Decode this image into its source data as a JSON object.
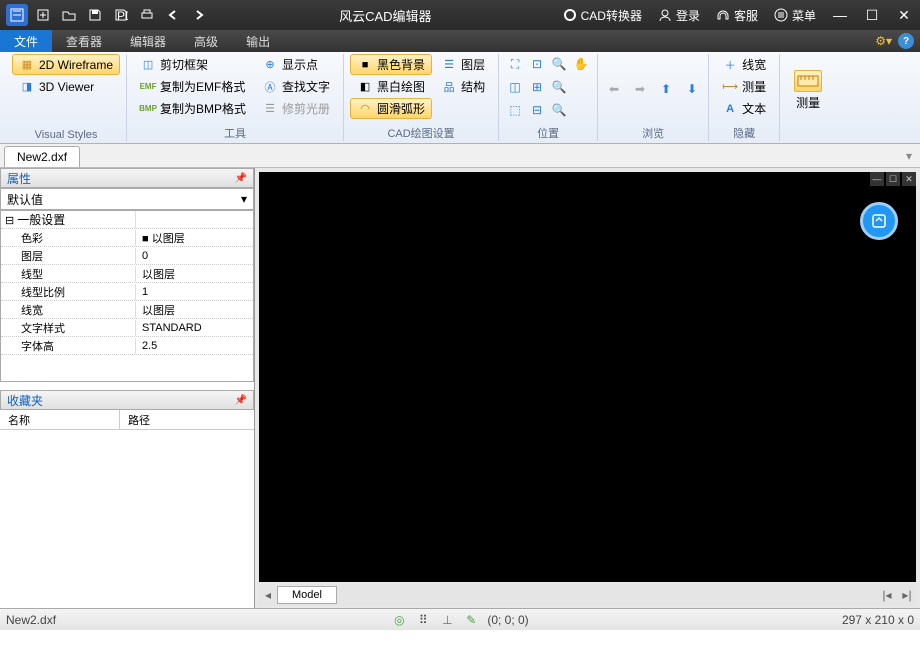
{
  "titlebar": {
    "title": "风云CAD编辑器",
    "converter": "CAD转换器",
    "login": "登录",
    "support": "客服",
    "menu": "菜单"
  },
  "menus": {
    "file": "文件",
    "viewer": "查看器",
    "editor": "编辑器",
    "advanced": "高级",
    "output": "输出"
  },
  "ribbon": {
    "vs": {
      "wireframe": "2D Wireframe",
      "viewer3d": "3D Viewer",
      "title": "Visual Styles"
    },
    "tools": {
      "crop": "剪切框架",
      "emf": "复制为EMF格式",
      "bmp": "复制为BMP格式",
      "showpt": "显示点",
      "findtext": "查找文字",
      "trim": "修剪光册",
      "title": "工具"
    },
    "cad": {
      "blackbg": "黑色背景",
      "bw": "黑白绘图",
      "arc": "圆滑弧形",
      "layer": "图层",
      "struct": "结构",
      "title": "CAD绘图设置"
    },
    "position": {
      "title": "位置"
    },
    "browse": {
      "title": "浏览"
    },
    "hide": {
      "linew": "线宽",
      "measure": "测量",
      "text": "文本",
      "title": "隐藏"
    },
    "measure": {
      "title": "测量"
    }
  },
  "doc": {
    "tab": "New2.dxf"
  },
  "props": {
    "title": "属性",
    "default": "默认值",
    "group": "一般设置",
    "rows": [
      {
        "k": "色彩",
        "v": "以图层",
        "swatch": true
      },
      {
        "k": "图层",
        "v": "0"
      },
      {
        "k": "线型",
        "v": "以图层"
      },
      {
        "k": "线型比例",
        "v": "1"
      },
      {
        "k": "线宽",
        "v": "以图层"
      },
      {
        "k": "文字样式",
        "v": "STANDARD"
      },
      {
        "k": "字体高",
        "v": "2.5"
      }
    ]
  },
  "fav": {
    "title": "收藏夹",
    "name": "名称",
    "path": "路径"
  },
  "model": {
    "tab": "Model"
  },
  "status": {
    "file": "New2.dxf",
    "coords": "(0; 0; 0)",
    "dims": "297 x 210 x 0"
  }
}
